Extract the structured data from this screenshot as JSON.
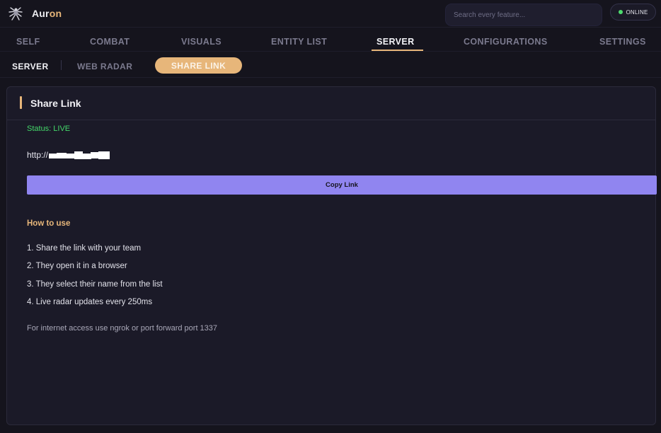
{
  "app": {
    "title_main": "Aur",
    "title_accent": "on"
  },
  "search": {
    "placeholder": "Search every feature..."
  },
  "status": {
    "label": "ONLINE",
    "color": "#4ddb6e"
  },
  "main_tabs": [
    {
      "label": "SELF",
      "active": false
    },
    {
      "label": "COMBAT",
      "active": false
    },
    {
      "label": "VISUALS",
      "active": false
    },
    {
      "label": "ENTITY LIST",
      "active": false
    },
    {
      "label": "SERVER",
      "active": true
    },
    {
      "label": "CONFIGURATIONS",
      "active": false
    },
    {
      "label": "SETTINGS",
      "active": false
    }
  ],
  "sub_tabs": [
    {
      "label": "SERVER",
      "active": false
    },
    {
      "label": "WEB RADAR",
      "active": false
    },
    {
      "label": "SHARE LINK",
      "active": true
    }
  ],
  "panel": {
    "title": "Share Link",
    "status_text": "Status: LIVE",
    "url_prefix": "http://",
    "copy_button": "Copy Link",
    "howto_title": "How to use",
    "steps": [
      "1. Share the link with your team",
      "2. They open it in a browser",
      "3. They select their name from the list",
      "4. Live radar updates every 250ms"
    ],
    "footnote": "For internet access use ngrok or port forward port 1337"
  },
  "colors": {
    "accent": "#e7b67a",
    "button": "#9085f0",
    "live": "#44d86a",
    "background": "#15141d",
    "panel": "#1b1a28"
  },
  "icons": {
    "logo": "spider-logo-icon",
    "status": "status-dot-icon"
  }
}
